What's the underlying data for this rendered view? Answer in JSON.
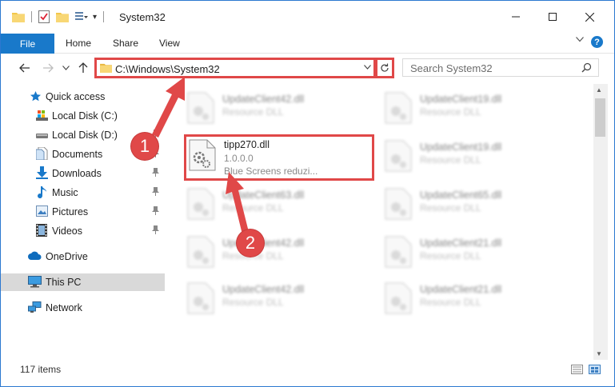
{
  "window": {
    "title": "System32",
    "controls": [
      "minimize",
      "maximize",
      "close"
    ]
  },
  "ribbon": {
    "tabs": [
      "File",
      "Home",
      "Share",
      "View"
    ]
  },
  "address": {
    "path": "C:\\Windows\\System32",
    "search_placeholder": "Search System32"
  },
  "nav": {
    "items": [
      {
        "label": "Quick access",
        "icon": "star-icon"
      },
      {
        "label": "Local Disk (C:)",
        "icon": "drive-icon"
      },
      {
        "label": "Local Disk (D:)",
        "icon": "drive-icon"
      },
      {
        "label": "Documents",
        "icon": "documents-icon",
        "pinned": true
      },
      {
        "label": "Downloads",
        "icon": "download-icon",
        "pinned": true
      },
      {
        "label": "Music",
        "icon": "music-icon",
        "pinned": true
      },
      {
        "label": "Pictures",
        "icon": "pictures-icon",
        "pinned": true
      },
      {
        "label": "Videos",
        "icon": "videos-icon",
        "pinned": true
      },
      {
        "label": "OneDrive",
        "icon": "cloud-icon"
      },
      {
        "label": "This PC",
        "icon": "computer-icon",
        "selected": true
      },
      {
        "label": "Network",
        "icon": "network-icon"
      }
    ]
  },
  "files": {
    "highlighted": {
      "name": "tipp270.dll",
      "version": "1.0.0.0",
      "description": "Blue Screens reduzi..."
    },
    "background": [
      {
        "name": "UpdateClient42.dll",
        "type": "Resource DLL"
      },
      {
        "name": "UpdateClient19.dll",
        "type": "Resource DLL"
      },
      {
        "name": "UpdateClient19.dll",
        "type": "Resource DLL"
      },
      {
        "name": "UpdateClient63.dll",
        "type": "Resource DLL"
      },
      {
        "name": "UpdateClient65.dll",
        "type": "Resource DLL"
      },
      {
        "name": "UpdateClient42.dll",
        "type": "Resource DLL"
      },
      {
        "name": "UpdateClient21.dll",
        "type": "Resource DLL"
      },
      {
        "name": "UpdateClient42.dll",
        "type": "Resource DLL"
      },
      {
        "name": "UpdateClient21.dll",
        "type": "Resource DLL"
      }
    ]
  },
  "status": {
    "items_count": "117 items"
  },
  "callouts": {
    "one": "1",
    "two": "2"
  },
  "colors": {
    "accent": "#1979ca",
    "highlight": "#e04848",
    "folder": "#f3c74b"
  }
}
